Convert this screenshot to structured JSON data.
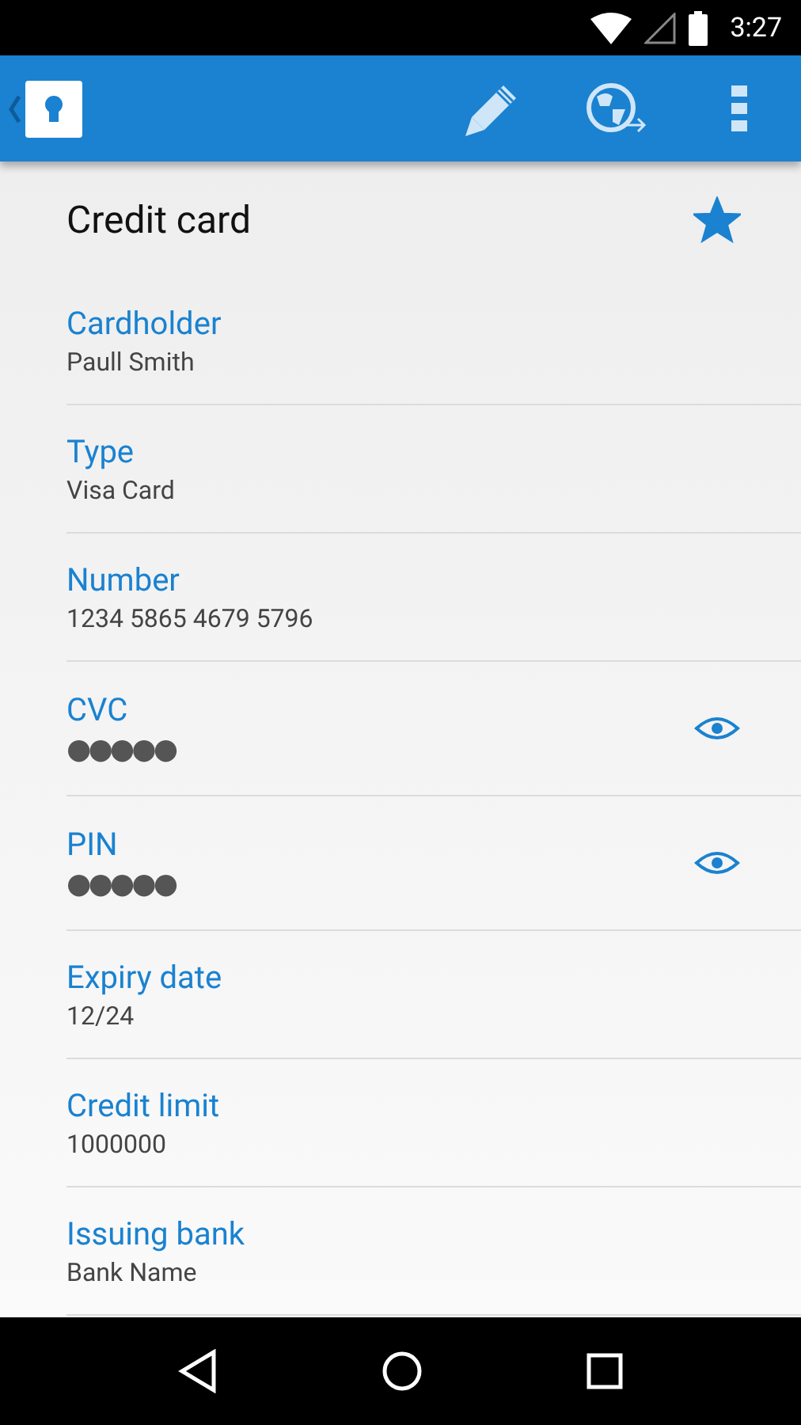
{
  "status_bar": {
    "time": "3:27"
  },
  "entry": {
    "title": "Credit card",
    "favorite": true
  },
  "fields": [
    {
      "label": "Cardholder",
      "value": "Paull Smith",
      "kind": "text"
    },
    {
      "label": "Type",
      "value": "Visa Card",
      "kind": "text"
    },
    {
      "label": "Number",
      "value": "1234 5865 4679 5796",
      "kind": "text"
    },
    {
      "label": "CVC",
      "value": "●●●●●",
      "kind": "secret"
    },
    {
      "label": "PIN",
      "value": "●●●●●",
      "kind": "secret"
    },
    {
      "label": "Expiry date",
      "value": "12/24",
      "kind": "text"
    },
    {
      "label": "Credit limit",
      "value": "1000000",
      "kind": "text"
    },
    {
      "label": "Issuing bank",
      "value": "Bank Name",
      "kind": "text"
    }
  ]
}
